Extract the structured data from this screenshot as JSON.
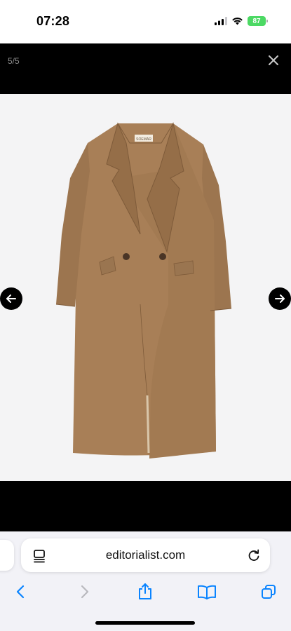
{
  "status_bar": {
    "time": "07:28",
    "battery": "87",
    "battery_color": "#4cd964",
    "icons": [
      "signal-icon",
      "wifi-icon",
      "battery-icon"
    ]
  },
  "viewer": {
    "counter": "5/5",
    "close_icon": "close-icon",
    "prev_icon": "arrow-left-icon",
    "next_icon": "arrow-right-icon",
    "product": {
      "description": "camel double-breasted long coat",
      "label_text": "SOEMAR",
      "coat_color": "#a87f57"
    }
  },
  "browser": {
    "url": "editorialist.com",
    "toolbar": [
      "back-icon",
      "forward-icon",
      "share-icon",
      "bookmarks-icon",
      "tabs-icon"
    ],
    "accent": "#0a84ff"
  }
}
